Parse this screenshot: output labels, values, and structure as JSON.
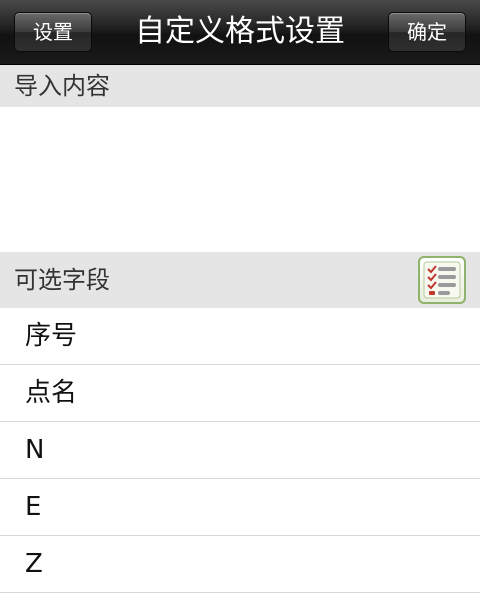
{
  "nav": {
    "title": "自定义格式设置",
    "left_button": "设置",
    "right_button": "确定"
  },
  "import_section": {
    "header": "导入内容"
  },
  "fields_section": {
    "header": "可选字段",
    "icon": "checklist-icon",
    "items": [
      "序号",
      "点名",
      "N",
      "E",
      "Z"
    ]
  },
  "colors": {
    "nav_bg": "#1a1a1a",
    "section_bg": "#e5e5e5",
    "icon_accent": "#8fb36a"
  }
}
